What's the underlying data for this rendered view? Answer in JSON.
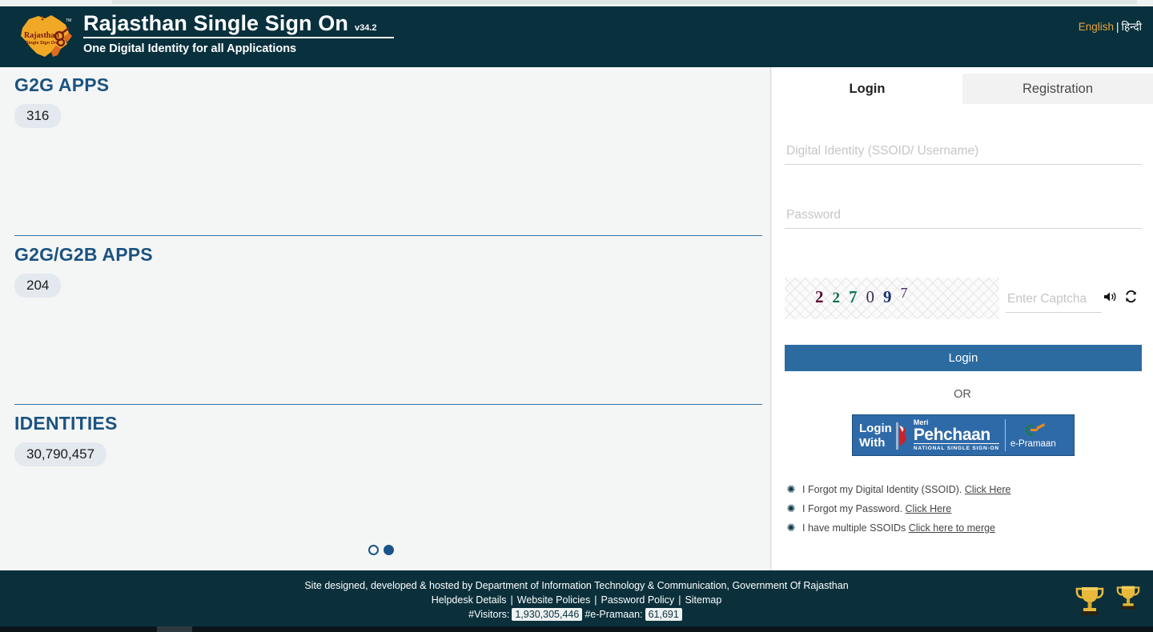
{
  "header": {
    "logo_icon": "rajasthan-map-logo",
    "logo_alt": "Rajasthan Single Sign On",
    "title": "Rajasthan Single Sign On",
    "version": "v34.2",
    "subtitle": "One Digital Identity for all Applications",
    "language": {
      "english": "English",
      "separator": "|",
      "hindi": "हिन्दी"
    },
    "bg_color": "#08303d",
    "accent_color": "#e8a33d"
  },
  "stats": [
    {
      "title": "G2G APPS",
      "value": "316"
    },
    {
      "title": "G2G/G2B APPS",
      "value": "204"
    },
    {
      "title": "IDENTITIES",
      "value": "30,790,457"
    }
  ],
  "carousel": {
    "dots": [
      "inactive",
      "active"
    ]
  },
  "login_panel": {
    "tabs": [
      {
        "label": "Login",
        "active": true
      },
      {
        "label": "Registration",
        "active": false
      }
    ],
    "username": {
      "placeholder": "Digital Identity (SSOID/ Username)",
      "value": ""
    },
    "password": {
      "placeholder": "Password",
      "value": ""
    },
    "captcha": {
      "digits": [
        "2",
        "2",
        "7",
        "0",
        "9",
        "7"
      ],
      "colors": [
        "#5c0b36",
        "#0b6b52",
        "#0f7a60",
        "#3d2b52",
        "#1b2f6e",
        "#4a2a66"
      ],
      "text": "227097",
      "input_placeholder": "Enter Captcha",
      "input_value": "",
      "speaker_icon": "speaker-icon",
      "refresh_icon": "refresh-icon"
    },
    "login_button": "Login",
    "or_label": "OR",
    "pehchaan": {
      "login_with_line1": "Login",
      "login_with_line2": "With",
      "meri": "Meri",
      "pehchaan": "Pehchaan",
      "tagline": "NATIONAL SINGLE SIGN-ON",
      "epramaan": "e-Pramaan"
    },
    "help_links": [
      {
        "bullet": "asterisk-icon",
        "text": "I Forgot my Digital Identity (SSOID).",
        "link": "Click Here"
      },
      {
        "bullet": "asterisk-icon",
        "text": "I Forgot my Password.",
        "link": "Click Here"
      },
      {
        "bullet": "asterisk-icon",
        "text": "I have multiple SSOIDs",
        "link": "Click here to merge"
      }
    ]
  },
  "footer": {
    "credit": "Site designed, developed & hosted by Department of Information Technology & Communication, Government Of Rajasthan",
    "links": [
      "Helpdesk Details",
      "Website Policies",
      "Password Policy",
      "Sitemap"
    ],
    "visitors_label": "#Visitors:",
    "visitors_count": "1,930,305,446",
    "epramaan_label": "#e-Pramaan:",
    "epramaan_count": "61,691",
    "trophy_icon": "trophy-icon",
    "bg_color": "#0b303c"
  }
}
